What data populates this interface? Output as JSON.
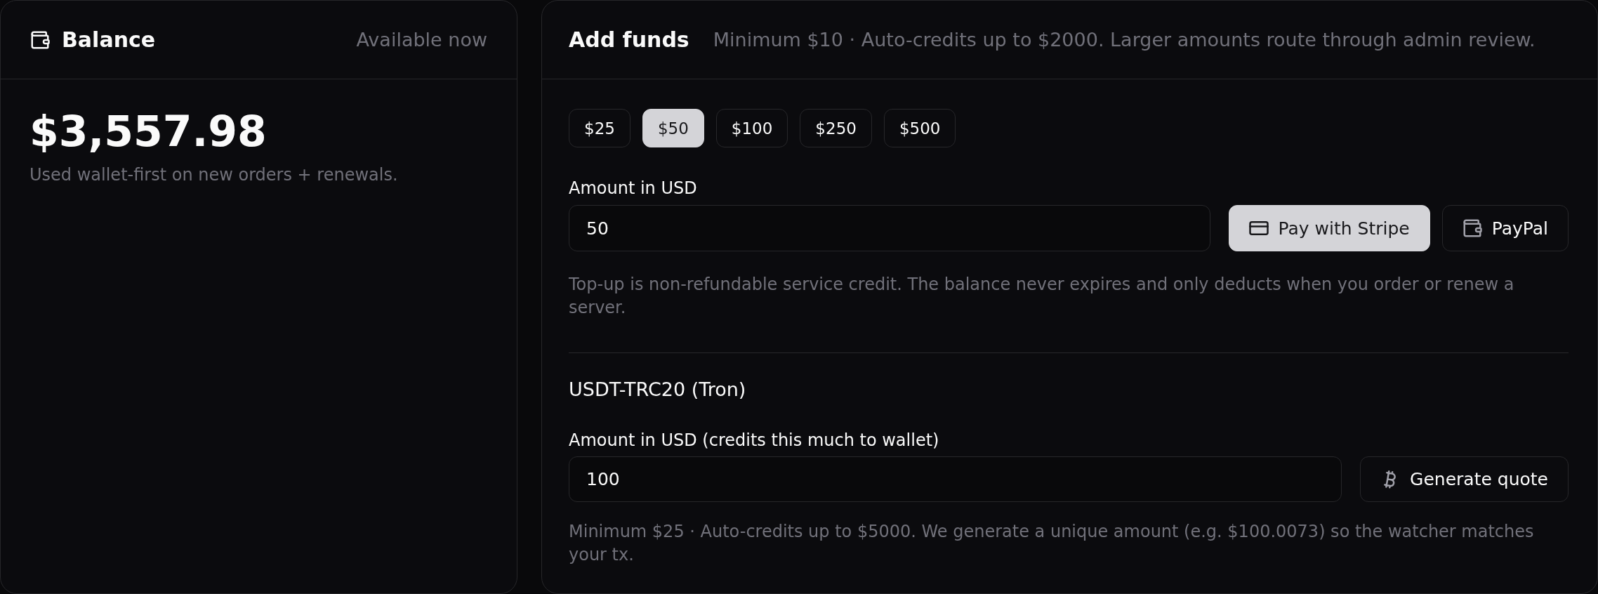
{
  "balance": {
    "title": "Balance",
    "status": "Available now",
    "amount": "$3,557.98",
    "note": "Used wallet-first on new orders + renewals."
  },
  "add_funds": {
    "title": "Add funds",
    "subtitle": "Minimum $10 · Auto-credits up to $2000. Larger amounts route through admin review.",
    "presets": [
      {
        "label": "$25",
        "selected": false
      },
      {
        "label": "$50",
        "selected": true
      },
      {
        "label": "$100",
        "selected": false
      },
      {
        "label": "$250",
        "selected": false
      },
      {
        "label": "$500",
        "selected": false
      }
    ],
    "amount_field": {
      "label": "Amount in USD",
      "value": "50"
    },
    "payment_buttons": [
      {
        "label": "Pay with Stripe",
        "kind": "primary"
      },
      {
        "label": "PayPal",
        "kind": "outline"
      }
    ],
    "note": "Top-up is non-refundable service credit. The balance never expires and only deducts when you order or renew a server.",
    "usdt": {
      "title": "USDT-TRC20 (Tron)",
      "amount_field": {
        "label": "Amount in USD (credits this much to wallet)",
        "value": "100"
      },
      "button": {
        "label": "Generate quote",
        "kind": "outline"
      },
      "note": "Minimum $25 · Auto-credits up to $5000. We generate a unique amount (e.g. $100.0073) so the watcher matches your tx."
    }
  }
}
